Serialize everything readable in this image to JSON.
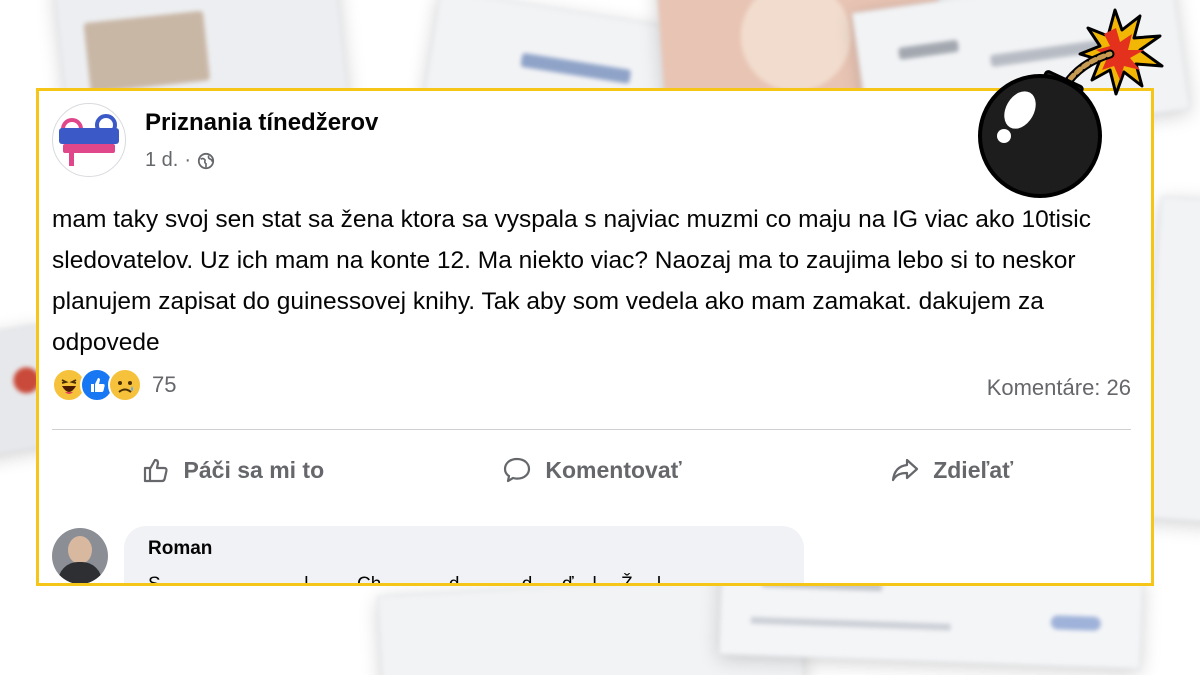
{
  "post": {
    "page_name": "Priznania tínedžerov",
    "time": "1 d.",
    "separator": "·",
    "text": "mam taky svoj sen stat sa žena ktora sa vyspala s najviac muzmi co maju na IG viac ako 10tisic sledovatelov. Uz ich mam na konte 12. Ma niekto viac? Naozaj ma to zaujima lebo si to neskor planujem zapisat do guinessovej knihy. Tak aby som vedela ako mam zamakat. dakujem za odpovede",
    "reactions": {
      "icons": [
        "haha-icon",
        "like-icon",
        "sad-icon"
      ],
      "count": "75"
    },
    "comments_count": "Komentáre: 26",
    "actions": {
      "like": "Páči sa mi to",
      "comment": "Komentovať",
      "share": "Zdieľať"
    }
  },
  "comment": {
    "author": "Roman",
    "text": "S…  …………… …l……. Ch… …… d… ……d…. ď…l… Ž …l…"
  },
  "colors": {
    "frame": "#f5c518",
    "text": "#050505",
    "muted": "#65676b",
    "like_blue": "#1877f2",
    "bubble": "#f0f2f5"
  }
}
